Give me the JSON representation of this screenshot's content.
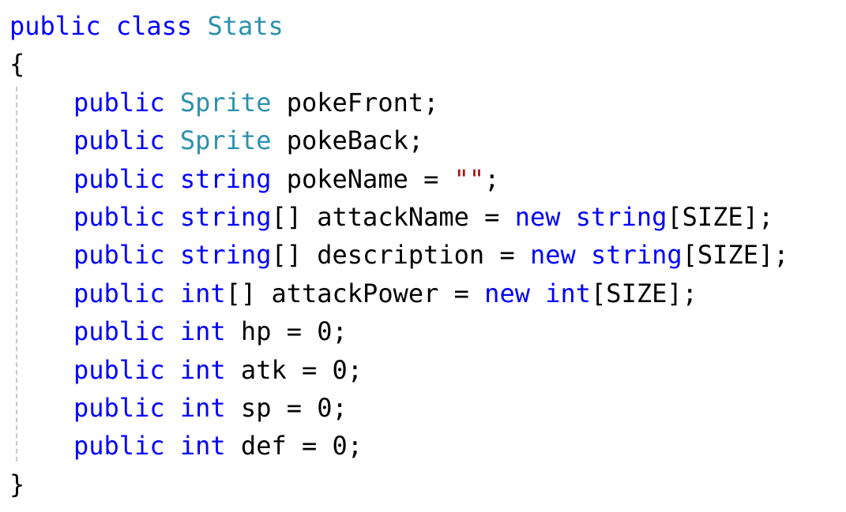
{
  "colors": {
    "keyword": "#0000ff",
    "type": "#2b91af",
    "string": "#a31515",
    "plain": "#000000",
    "guide": "#c8c8c8"
  },
  "lines": [
    [
      {
        "t": "public",
        "c": "keyword"
      },
      {
        "t": " ",
        "c": "plain"
      },
      {
        "t": "class",
        "c": "keyword"
      },
      {
        "t": " ",
        "c": "plain"
      },
      {
        "t": "Stats",
        "c": "type"
      }
    ],
    [
      {
        "t": "{",
        "c": "plain"
      }
    ],
    [
      {
        "t": "public",
        "c": "keyword",
        "indent": 1
      },
      {
        "t": " ",
        "c": "plain"
      },
      {
        "t": "Sprite",
        "c": "type"
      },
      {
        "t": " pokeFront;",
        "c": "plain"
      }
    ],
    [
      {
        "t": "public",
        "c": "keyword",
        "indent": 1
      },
      {
        "t": " ",
        "c": "plain"
      },
      {
        "t": "Sprite",
        "c": "type"
      },
      {
        "t": " pokeBack;",
        "c": "plain"
      }
    ],
    [
      {
        "t": "public",
        "c": "keyword",
        "indent": 1
      },
      {
        "t": " ",
        "c": "plain"
      },
      {
        "t": "string",
        "c": "keyword"
      },
      {
        "t": " pokeName = ",
        "c": "plain"
      },
      {
        "t": "\"\"",
        "c": "string"
      },
      {
        "t": ";",
        "c": "plain"
      }
    ],
    [
      {
        "t": "public",
        "c": "keyword",
        "indent": 1
      },
      {
        "t": " ",
        "c": "plain"
      },
      {
        "t": "string",
        "c": "keyword"
      },
      {
        "t": "[] attackName = ",
        "c": "plain"
      },
      {
        "t": "new",
        "c": "keyword"
      },
      {
        "t": " ",
        "c": "plain"
      },
      {
        "t": "string",
        "c": "keyword"
      },
      {
        "t": "[SIZE];",
        "c": "plain"
      }
    ],
    [
      {
        "t": "public",
        "c": "keyword",
        "indent": 1
      },
      {
        "t": " ",
        "c": "plain"
      },
      {
        "t": "string",
        "c": "keyword"
      },
      {
        "t": "[] description = ",
        "c": "plain"
      },
      {
        "t": "new",
        "c": "keyword"
      },
      {
        "t": " ",
        "c": "plain"
      },
      {
        "t": "string",
        "c": "keyword"
      },
      {
        "t": "[SIZE];",
        "c": "plain"
      }
    ],
    [
      {
        "t": "public",
        "c": "keyword",
        "indent": 1
      },
      {
        "t": " ",
        "c": "plain"
      },
      {
        "t": "int",
        "c": "keyword"
      },
      {
        "t": "[] attackPower = ",
        "c": "plain"
      },
      {
        "t": "new",
        "c": "keyword"
      },
      {
        "t": " ",
        "c": "plain"
      },
      {
        "t": "int",
        "c": "keyword"
      },
      {
        "t": "[SIZE];",
        "c": "plain"
      }
    ],
    [
      {
        "t": "public",
        "c": "keyword",
        "indent": 1
      },
      {
        "t": " ",
        "c": "plain"
      },
      {
        "t": "int",
        "c": "keyword"
      },
      {
        "t": " hp = 0;",
        "c": "plain"
      }
    ],
    [
      {
        "t": "public",
        "c": "keyword",
        "indent": 1
      },
      {
        "t": " ",
        "c": "plain"
      },
      {
        "t": "int",
        "c": "keyword"
      },
      {
        "t": " atk = 0;",
        "c": "plain"
      }
    ],
    [
      {
        "t": "public",
        "c": "keyword",
        "indent": 1
      },
      {
        "t": " ",
        "c": "plain"
      },
      {
        "t": "int",
        "c": "keyword"
      },
      {
        "t": " sp = 0;",
        "c": "plain"
      }
    ],
    [
      {
        "t": "public",
        "c": "keyword",
        "indent": 1
      },
      {
        "t": " ",
        "c": "plain"
      },
      {
        "t": "int",
        "c": "keyword"
      },
      {
        "t": " def = 0;",
        "c": "plain"
      }
    ],
    [
      {
        "t": "}",
        "c": "plain"
      }
    ]
  ]
}
